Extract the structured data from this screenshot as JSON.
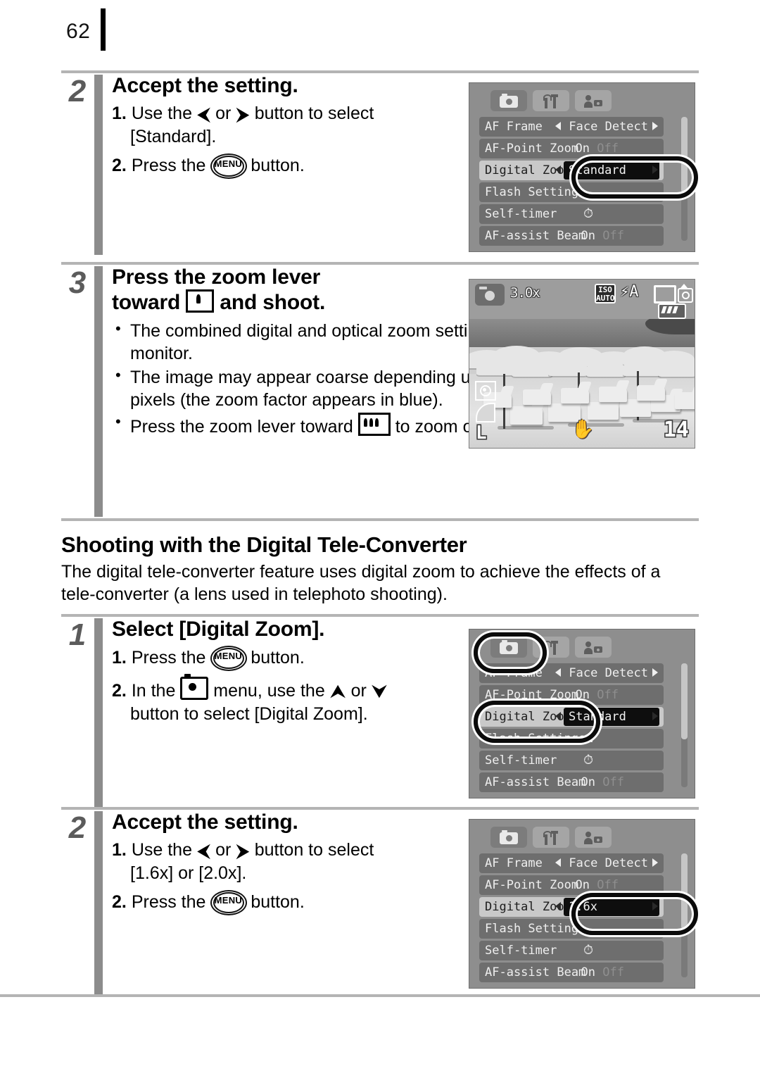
{
  "page": {
    "number": "62"
  },
  "steps": [
    {
      "id": "step2a",
      "number": "2",
      "title": "Accept the setting.",
      "sub1_num": "1.",
      "sub1_a": "Use the",
      "sub1_b": "or",
      "sub1_c": "button to select",
      "sub1_cont": "[Standard].",
      "sub2_num": "2.",
      "sub2_a": "Press the",
      "sub2_b": "button."
    },
    {
      "id": "step3",
      "number": "3",
      "title_a": "Press the zoom lever",
      "title_b": "toward",
      "title_c": "and shoot.",
      "bullets": [
        "The combined digital and optical zoom setting will display in the LCD monitor.",
        "The image may appear coarse depending upon the selected recording pixels (the zoom factor appears in blue)."
      ],
      "bullet3_a": "Press the zoom lever toward",
      "bullet3_b": "to zoom out."
    },
    {
      "id": "step1b",
      "number": "1",
      "title": "Select [Digital Zoom].",
      "sub1_num": "1.",
      "sub1_a": "Press the",
      "sub1_b": "button.",
      "sub2_num": "2.",
      "sub2_a": "In the",
      "sub2_b": "menu, use the",
      "sub2_c": "or",
      "sub2_cont": "button to select [Digital Zoom]."
    },
    {
      "id": "step2b",
      "number": "2",
      "title": "Accept the setting.",
      "sub1_num": "1.",
      "sub1_a": "Use the",
      "sub1_b": "or",
      "sub1_c": "button to select",
      "sub1_cont": "[1.6x] or [2.0x].",
      "sub2_num": "2.",
      "sub2_a": "Press the",
      "sub2_b": "button."
    }
  ],
  "section": {
    "title": "Shooting with the Digital Tele-Converter",
    "body": "The digital tele-converter feature uses digital zoom to achieve the effects of a tele-converter (a lens used in telephoto shooting)."
  },
  "glyphs": {
    "menu_button_label": "MENU",
    "left_arrow": "⮜",
    "right_arrow": "⮞",
    "up_arrow": "⮝",
    "down_arrow": "⮟"
  },
  "camera_menu": {
    "tabs": [
      {
        "name": "shooting-tab",
        "icon": "camera-icon",
        "selected": true
      },
      {
        "name": "setup-tab",
        "icon": "wrench-icon",
        "selected": false
      },
      {
        "name": "my-camera-tab",
        "icon": "my-camera-icon",
        "selected": false
      }
    ],
    "rows": [
      {
        "label": "AF Frame",
        "value": "Face Detect",
        "type": "arrows"
      },
      {
        "label": "AF-Point Zoom",
        "value_on": "On",
        "value_off": "Off",
        "type": "onoff"
      },
      {
        "label": "Digital Zoom",
        "value": "Standard",
        "type": "selected"
      },
      {
        "label": "Flash Settings…",
        "value": "",
        "type": "plain"
      },
      {
        "label": "Self-timer",
        "value": "⏱",
        "type": "icon"
      },
      {
        "label": "AF-assist Beam",
        "value_on": "On",
        "value_off": "Off",
        "type": "onoff"
      }
    ],
    "variant_16x_value": "1.6x"
  },
  "lcd": {
    "zoom_factor": "3.0x",
    "iso_line1": "ISO",
    "iso_line2": "AUTO",
    "flash_mode": "⚡A",
    "shots_remaining": "14",
    "quality_label": "L",
    "battery": "battery-icon",
    "shake_warning": "✋"
  },
  "colors": {
    "rule": "#b4b4b4",
    "step_number": "#5b5b5b",
    "step_bar": "#8c8c8c",
    "menu_bg": "#8e8e8e",
    "menu_row": "#6e6e6e",
    "menu_row_active": "#c9c9c9",
    "selection_box": "#0e0e0e",
    "highlight_oval": "#0b0b0b"
  }
}
